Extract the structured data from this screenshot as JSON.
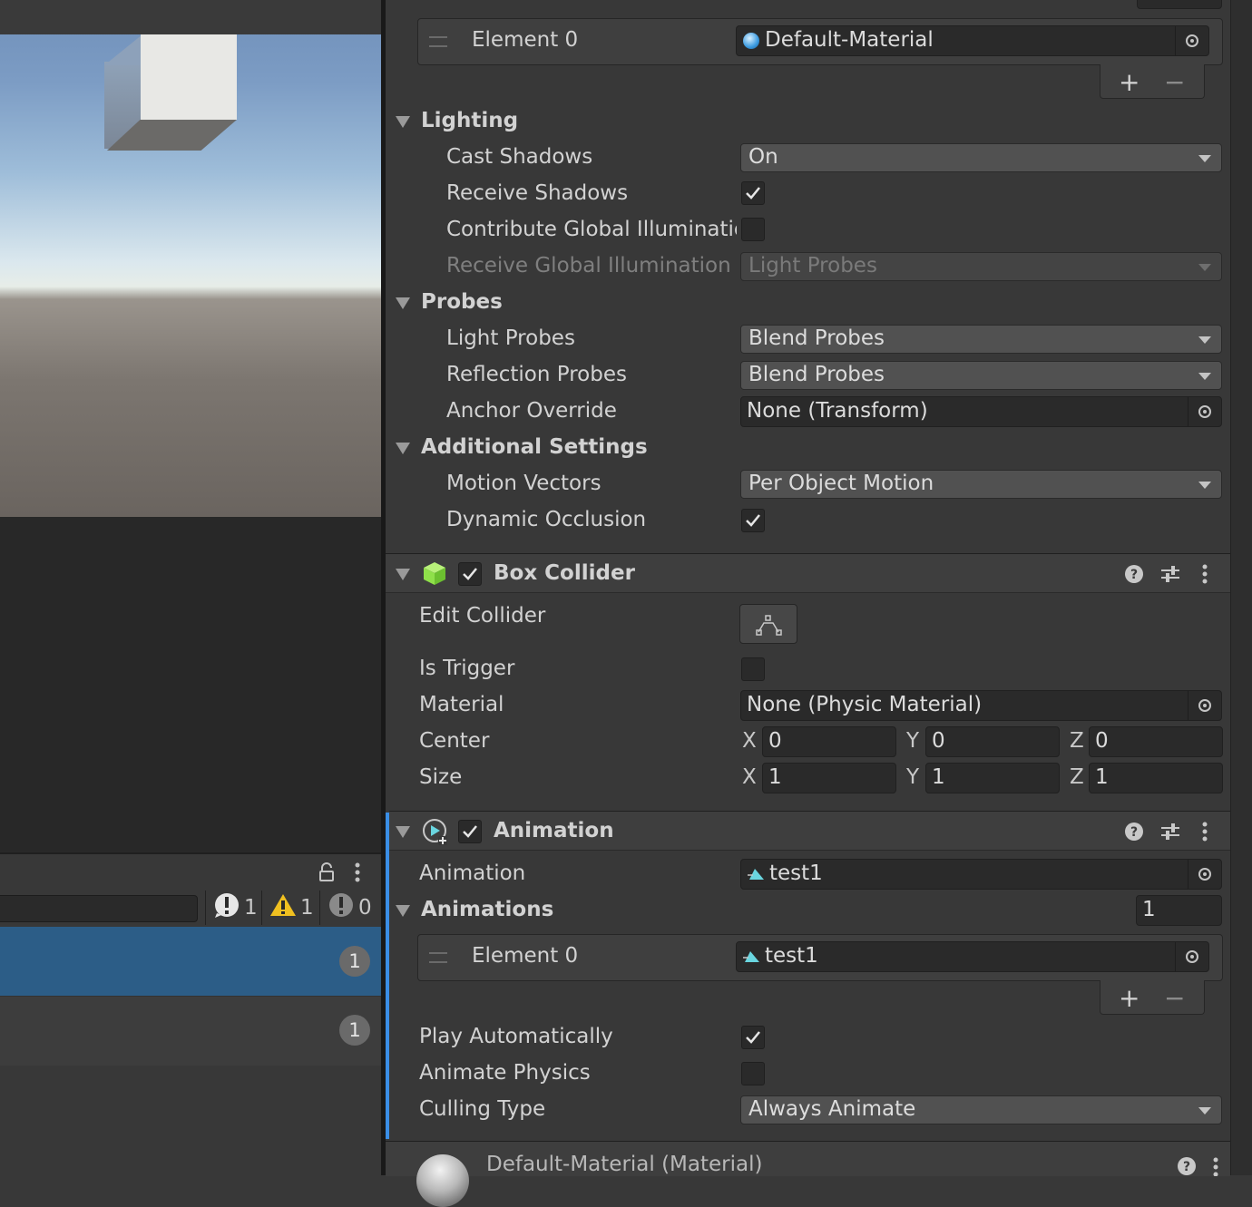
{
  "console": {
    "counts": {
      "errors": "1",
      "warnings": "1",
      "messages": "0"
    },
    "rows": [
      {
        "badge": "1"
      },
      {
        "badge": "1"
      }
    ]
  },
  "materials": {
    "element0_label": "Element 0",
    "element0_value": "Default-Material"
  },
  "lighting": {
    "header": "Lighting",
    "cast_shadows": {
      "label": "Cast Shadows",
      "value": "On"
    },
    "receive_shadows": {
      "label": "Receive Shadows",
      "checked": true
    },
    "contribute_gi": {
      "label": "Contribute Global Illuminatior",
      "checked": false
    },
    "receive_gi": {
      "label": "Receive Global Illumination",
      "value": "Light Probes"
    }
  },
  "probes": {
    "header": "Probes",
    "light_probes": {
      "label": "Light Probes",
      "value": "Blend Probes"
    },
    "reflection_probes": {
      "label": "Reflection Probes",
      "value": "Blend Probes"
    },
    "anchor_override": {
      "label": "Anchor Override",
      "value": "None (Transform)"
    }
  },
  "additional": {
    "header": "Additional Settings",
    "motion_vectors": {
      "label": "Motion Vectors",
      "value": "Per Object Motion"
    },
    "dynamic_occlusion": {
      "label": "Dynamic Occlusion",
      "checked": true
    }
  },
  "box_collider": {
    "title": "Box Collider",
    "enabled": true,
    "edit_collider": "Edit Collider",
    "is_trigger": {
      "label": "Is Trigger",
      "checked": false
    },
    "material": {
      "label": "Material",
      "value": "None (Physic Material)"
    },
    "center": {
      "label": "Center",
      "x": "0",
      "y": "0",
      "z": "0"
    },
    "size": {
      "label": "Size",
      "x": "1",
      "y": "1",
      "z": "1"
    },
    "axis_labels": {
      "x": "X",
      "y": "Y",
      "z": "Z"
    }
  },
  "animation": {
    "title": "Animation",
    "enabled": true,
    "clip": {
      "label": "Animation",
      "value": "test1"
    },
    "animations": {
      "header": "Animations",
      "count": "1",
      "element0_label": "Element 0",
      "element0_value": "test1"
    },
    "play_automatically": {
      "label": "Play Automatically",
      "checked": true
    },
    "animate_physics": {
      "label": "Animate Physics",
      "checked": false
    },
    "culling_type": {
      "label": "Culling Type",
      "value": "Always Animate"
    }
  },
  "material_footer": {
    "title": "Default-Material (Material)"
  },
  "colors": {
    "selection": "#2c5d87",
    "collider_green": "#8fe04a",
    "anim_accent": "#3a8ee6",
    "warning": "#f0c020"
  }
}
